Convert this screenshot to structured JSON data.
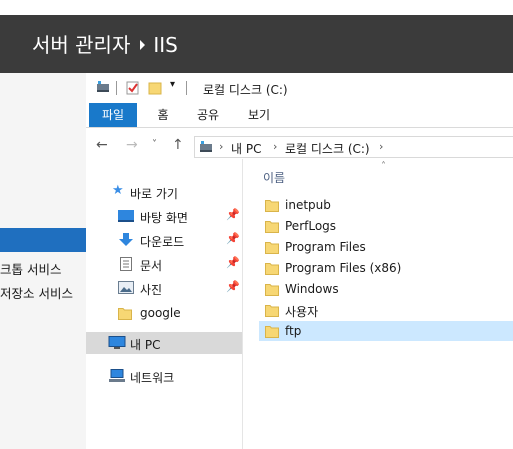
{
  "server_manager": {
    "title": "서버 관리자",
    "breadcrumb": "IIS",
    "left_items": [
      "크톱 서비스",
      "저장소 서비스"
    ]
  },
  "explorer": {
    "window_title": "로컬 디스크 (C:)",
    "ribbon_tabs": [
      "파일",
      "홈",
      "공유",
      "보기"
    ],
    "address": {
      "crumbs": [
        "내 PC",
        "로컬 디스크 (C:)"
      ]
    },
    "nav": {
      "quick_access": "바로 가기",
      "items": [
        {
          "label": "바탕 화면",
          "icon": "desktop-icon",
          "pinned": true
        },
        {
          "label": "다운로드",
          "icon": "download-icon",
          "pinned": true
        },
        {
          "label": "문서",
          "icon": "document-icon",
          "pinned": true
        },
        {
          "label": "사진",
          "icon": "pictures-icon",
          "pinned": true
        },
        {
          "label": "google",
          "icon": "folder-icon",
          "pinned": false
        }
      ],
      "this_pc": "내 PC",
      "network": "네트워크"
    },
    "content": {
      "column_header": "이름",
      "files": [
        {
          "name": "inetpub"
        },
        {
          "name": "PerfLogs"
        },
        {
          "name": "Program Files"
        },
        {
          "name": "Program Files (x86)"
        },
        {
          "name": "Windows"
        },
        {
          "name": "사용자"
        },
        {
          "name": "ftp",
          "selected": true
        }
      ]
    }
  },
  "colors": {
    "header_bg": "#3b3b3b",
    "ribbon_file_tab": "#1979ca",
    "selected_nav": "#d9d9d9",
    "selected_file": "#cce8ff",
    "folder": "#f7d774"
  }
}
